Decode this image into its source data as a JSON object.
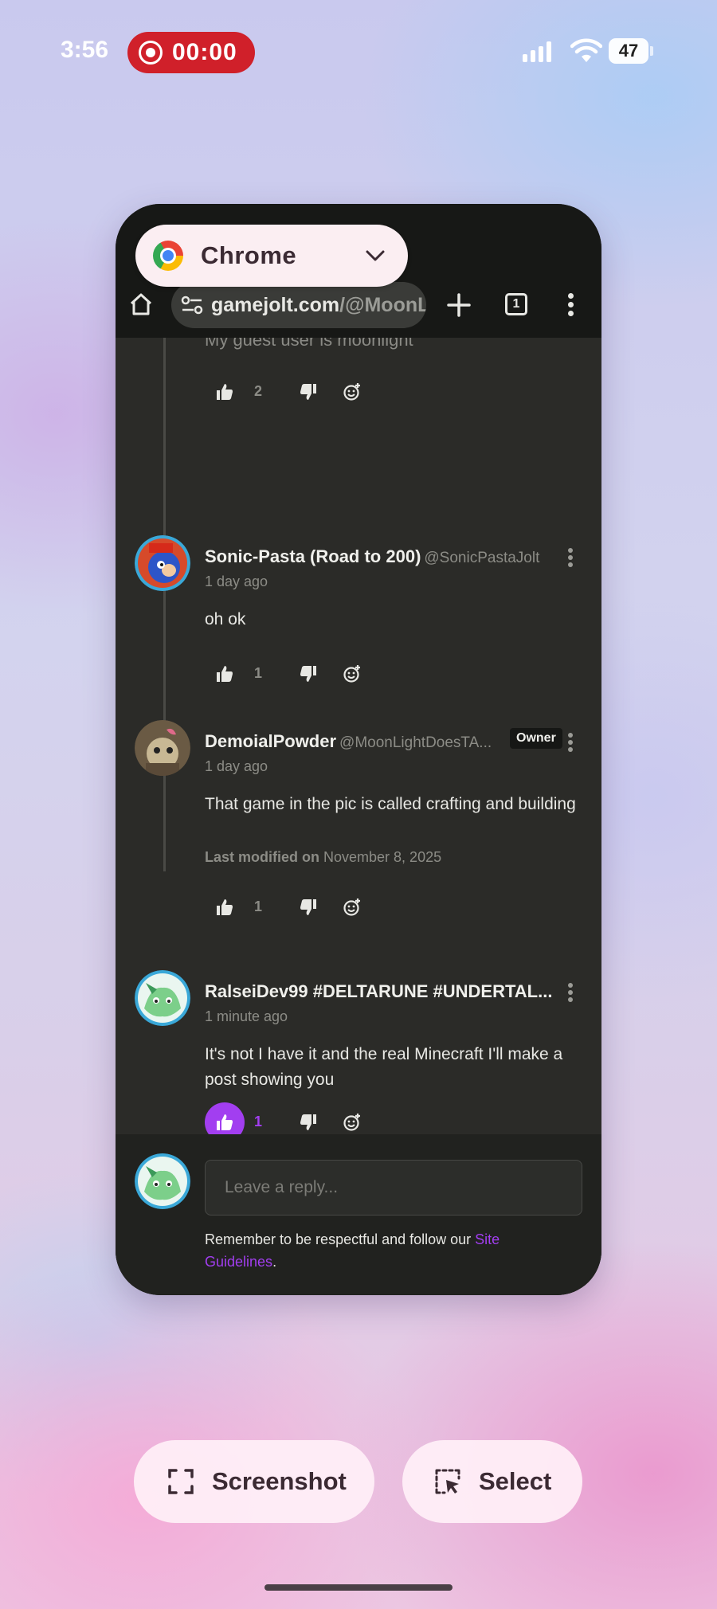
{
  "status_bar": {
    "time": "3:56",
    "recording_time": "00:00",
    "battery": "47"
  },
  "app_switcher": {
    "app_name": "Chrome"
  },
  "browser": {
    "url_main": "gamejolt.com",
    "url_rest": "/@MoonL",
    "tab_count": "1"
  },
  "comments": {
    "clipped_text": "My guest user is moonlight",
    "clipped_likes": "2",
    "items": [
      {
        "author": "Sonic-Pasta (Road to 200)",
        "handle": "@SonicPastaJolt",
        "time": "1 day ago",
        "text": "oh ok",
        "likes": "1"
      },
      {
        "author": "DemoialPowder",
        "handle": "@MoonLightDoesTA...",
        "badge": "Owner",
        "time": "1 day ago",
        "text": "That game in the pic is called crafting and building",
        "modified_label": "Last modified on",
        "modified_date": "November 8, 2025",
        "likes": "1"
      },
      {
        "author": "RalseiDev99 #DELTARUNE #UNDERTAL...",
        "time": "1 minute ago",
        "text": "It's not I have it and the real Minecraft I'll make a post showing you",
        "likes": "1"
      }
    ]
  },
  "reply": {
    "placeholder": "Leave a reply...",
    "guidelines_text": "Remember to be respectful and follow our ",
    "guidelines_link": "Site Guidelines",
    "guidelines_end": "."
  },
  "bottom_actions": {
    "screenshot_label": "Screenshot",
    "select_label": "Select"
  },
  "colors": {
    "accent": "#a23ef0",
    "recording": "#d0202a",
    "card_bg": "#2b2b28"
  }
}
